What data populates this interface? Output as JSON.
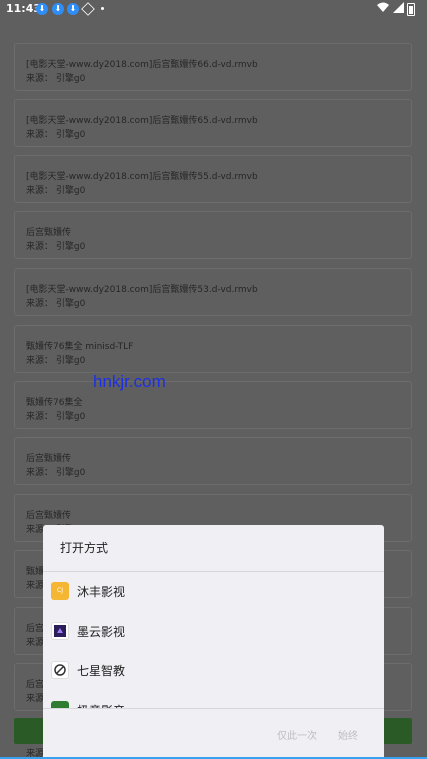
{
  "status_bar": {
    "time": "11:43"
  },
  "list": {
    "items": [
      {
        "title": "[电影天堂-www.dy2018.com]后宫甄嬛传66.d-vd.rmvb",
        "source": "来源： 引擎g0"
      },
      {
        "title": "[电影天堂-www.dy2018.com]后宫甄嬛传65.d-vd.rmvb",
        "source": "来源： 引擎g0"
      },
      {
        "title": "[电影天堂-www.dy2018.com]后宫甄嬛传55.d-vd.rmvb",
        "source": "来源： 引擎g0"
      },
      {
        "title": "后宫甄嬛传",
        "source": "来源： 引擎g0"
      },
      {
        "title": "[电影天堂-www.dy2018.com]后宫甄嬛传53.d-vd.rmvb",
        "source": "来源： 引擎g0"
      },
      {
        "title": "甄嬛传76集全 minisd-TLF",
        "source": "来源： 引擎g0"
      },
      {
        "title": "甄嬛传76集全",
        "source": "来源： 引擎g0"
      },
      {
        "title": "后宫甄嬛传",
        "source": "来源： 引擎g0"
      },
      {
        "title": "后宫甄嬛传",
        "source": "来源： 引擎g0"
      },
      {
        "title": "甄嬛",
        "source": "来源"
      },
      {
        "title": "后宫",
        "source": "来源"
      },
      {
        "title": "后宫",
        "source": "来源"
      }
    ],
    "bottom_label": "来源"
  },
  "watermark": "hnkjr.com",
  "dialog": {
    "title": "打开方式",
    "apps": [
      {
        "label": "沐丰影视",
        "icon": "mufeng-app-icon",
        "icon_text": "CJ",
        "icon_color": "#f5b733"
      },
      {
        "label": "墨云影视",
        "icon": "moyun-app-icon",
        "icon_text": "",
        "icon_color": "#2b1c5a"
      },
      {
        "label": "七星智教",
        "icon": "qixing-app-icon",
        "icon_text": "",
        "icon_color": "#ffffff"
      },
      {
        "label": "极意影音",
        "icon": "jiyi-app-icon",
        "icon_text": "",
        "icon_color": "#2e7d32"
      }
    ],
    "buttons": {
      "once": "仅此一次",
      "always": "始终"
    }
  }
}
